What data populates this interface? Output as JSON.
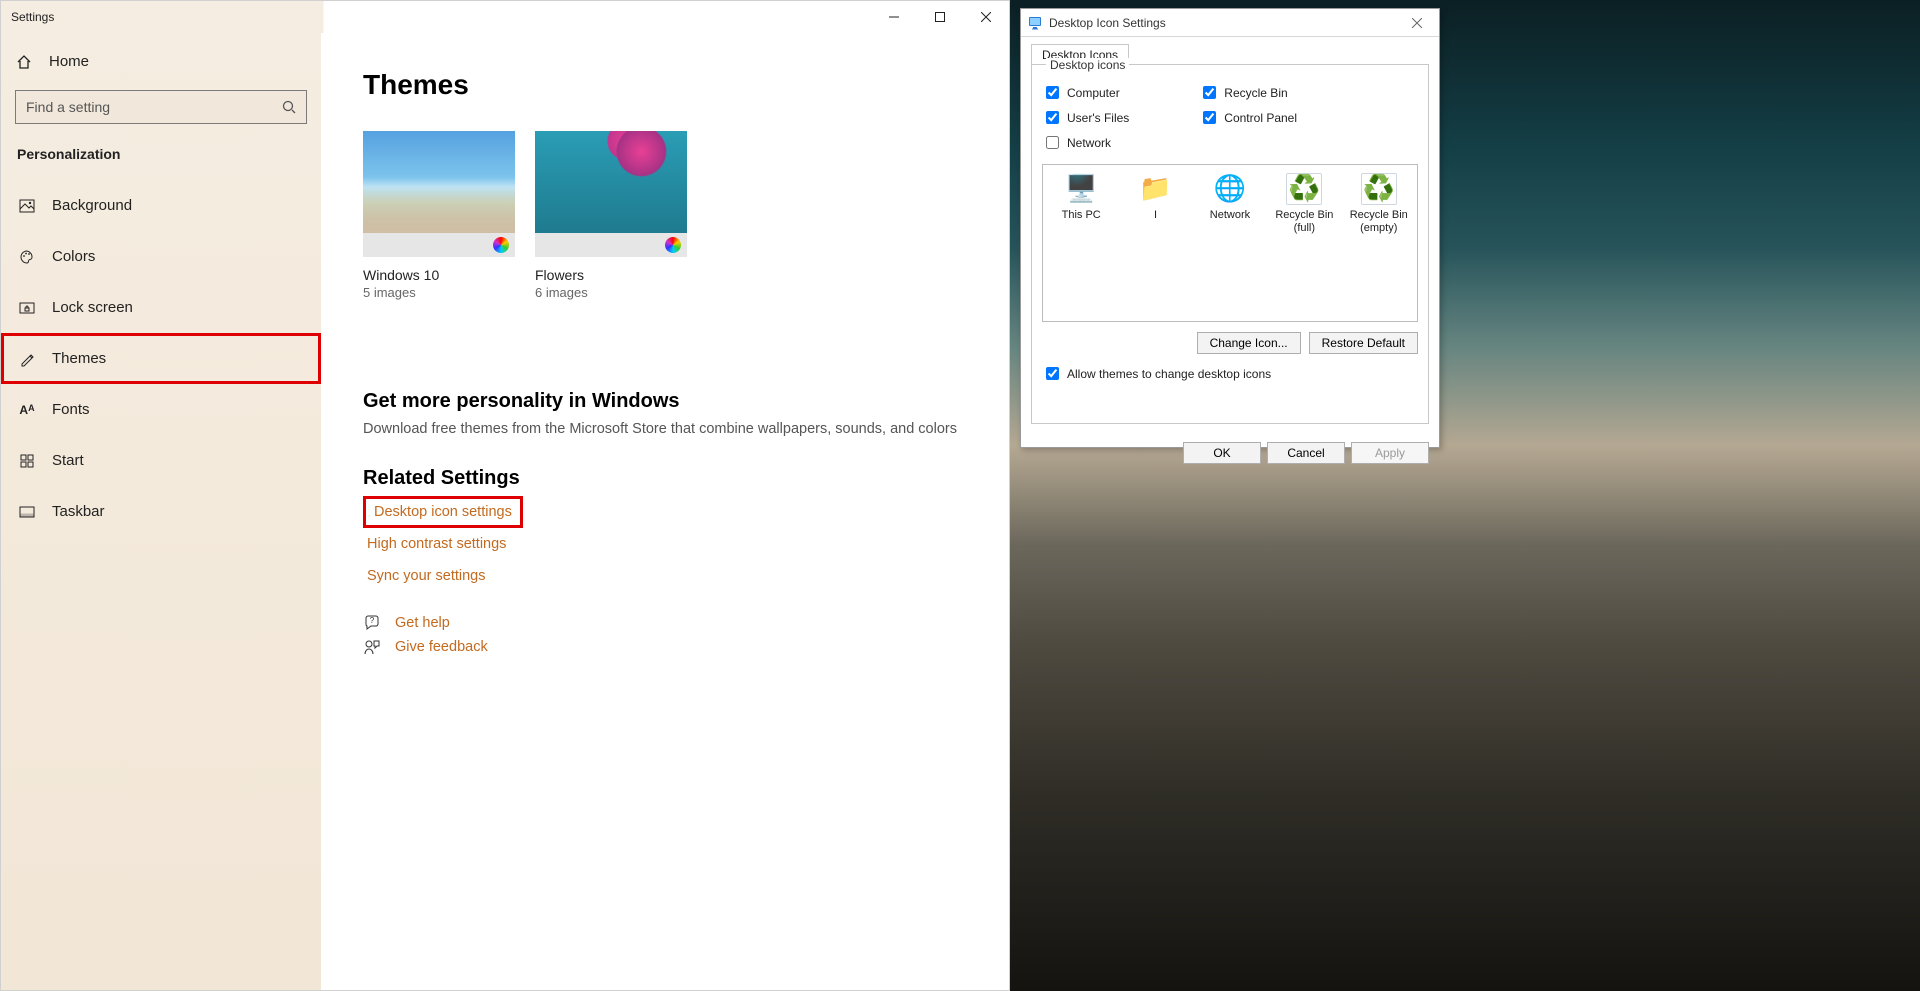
{
  "settings": {
    "title": "Settings",
    "home": "Home",
    "search_placeholder": "Find a setting",
    "section": "Personalization",
    "nav": [
      {
        "label": "Background"
      },
      {
        "label": "Colors"
      },
      {
        "label": "Lock screen"
      },
      {
        "label": "Themes"
      },
      {
        "label": "Fonts"
      },
      {
        "label": "Start"
      },
      {
        "label": "Taskbar"
      }
    ],
    "page_title": "Themes",
    "themes": [
      {
        "name": "Windows 10",
        "sub": "5 images"
      },
      {
        "name": "Flowers",
        "sub": "6 images"
      }
    ],
    "more_h": "Get more personality in Windows",
    "more_p": "Download free themes from the Microsoft Store that combine wallpapers, sounds, and colors",
    "related_h": "Related Settings",
    "related_links": [
      "Desktop icon settings",
      "High contrast settings",
      "Sync your settings"
    ],
    "help": "Get help",
    "feedback": "Give feedback"
  },
  "dialog": {
    "title": "Desktop Icon Settings",
    "tab": "Desktop Icons",
    "group": "Desktop icons",
    "checkboxes": {
      "computer": "Computer",
      "users_files": "User's Files",
      "network": "Network",
      "recycle_bin": "Recycle Bin",
      "control_panel": "Control Panel"
    },
    "checkbox_state": {
      "computer": true,
      "users_files": true,
      "network": false,
      "recycle_bin": true,
      "control_panel": true
    },
    "icons": [
      "This PC",
      "I",
      "Network",
      "Recycle Bin (full)",
      "Recycle Bin (empty)"
    ],
    "change_icon": "Change Icon...",
    "restore_default": "Restore Default",
    "allow_themes": "Allow themes to change desktop icons",
    "allow_themes_checked": true,
    "ok": "OK",
    "cancel": "Cancel",
    "apply": "Apply"
  }
}
